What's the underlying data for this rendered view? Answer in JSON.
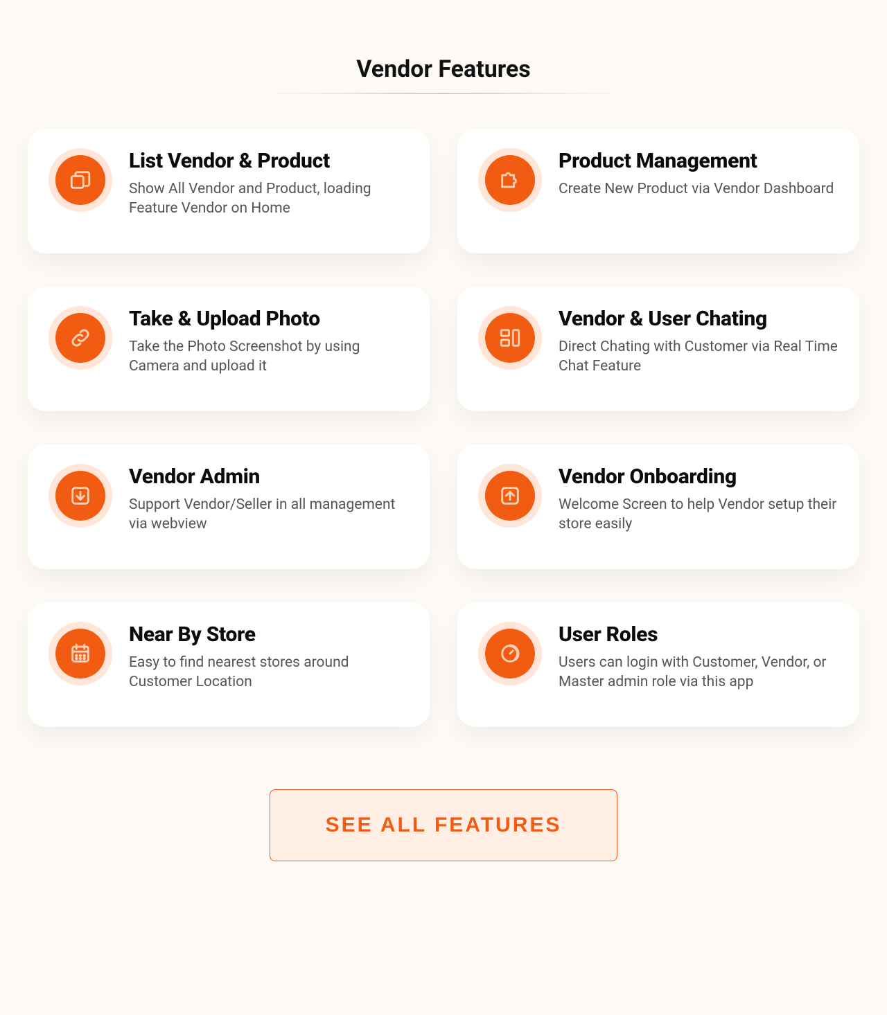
{
  "section": {
    "title": "Vendor Features"
  },
  "features": [
    {
      "icon": "layers-icon",
      "title": "List Vendor & Product",
      "desc": "Show All Vendor and Product, loading Feature Vendor on Home"
    },
    {
      "icon": "puzzle-icon",
      "title": "Product Management",
      "desc": "Create New Product via Vendor Dashboard"
    },
    {
      "icon": "link-icon",
      "title": "Take & Upload Photo",
      "desc": "Take the Photo Screenshot by using Camera and upload it"
    },
    {
      "icon": "grid-icon",
      "title": "Vendor & User Chating",
      "desc": "Direct Chating with Customer via Real Time Chat Feature"
    },
    {
      "icon": "download-icon",
      "title": "Vendor Admin",
      "desc": "Support Vendor/Seller in all management via webview"
    },
    {
      "icon": "upload-icon",
      "title": "Vendor Onboarding",
      "desc": "Welcome Screen to help Vendor setup their store easily"
    },
    {
      "icon": "calendar-icon",
      "title": "Near By Store",
      "desc": "Easy to find nearest stores around Customer Location"
    },
    {
      "icon": "gauge-icon",
      "title": "User Roles",
      "desc": "Users can login with Customer, Vendor, or Master admin role via this app"
    }
  ],
  "cta": {
    "label": "SEE ALL FEATURES"
  },
  "colors": {
    "accent": "#f25c12",
    "accentLight": "#ffe6d8",
    "bg": "#fdf9f4"
  }
}
